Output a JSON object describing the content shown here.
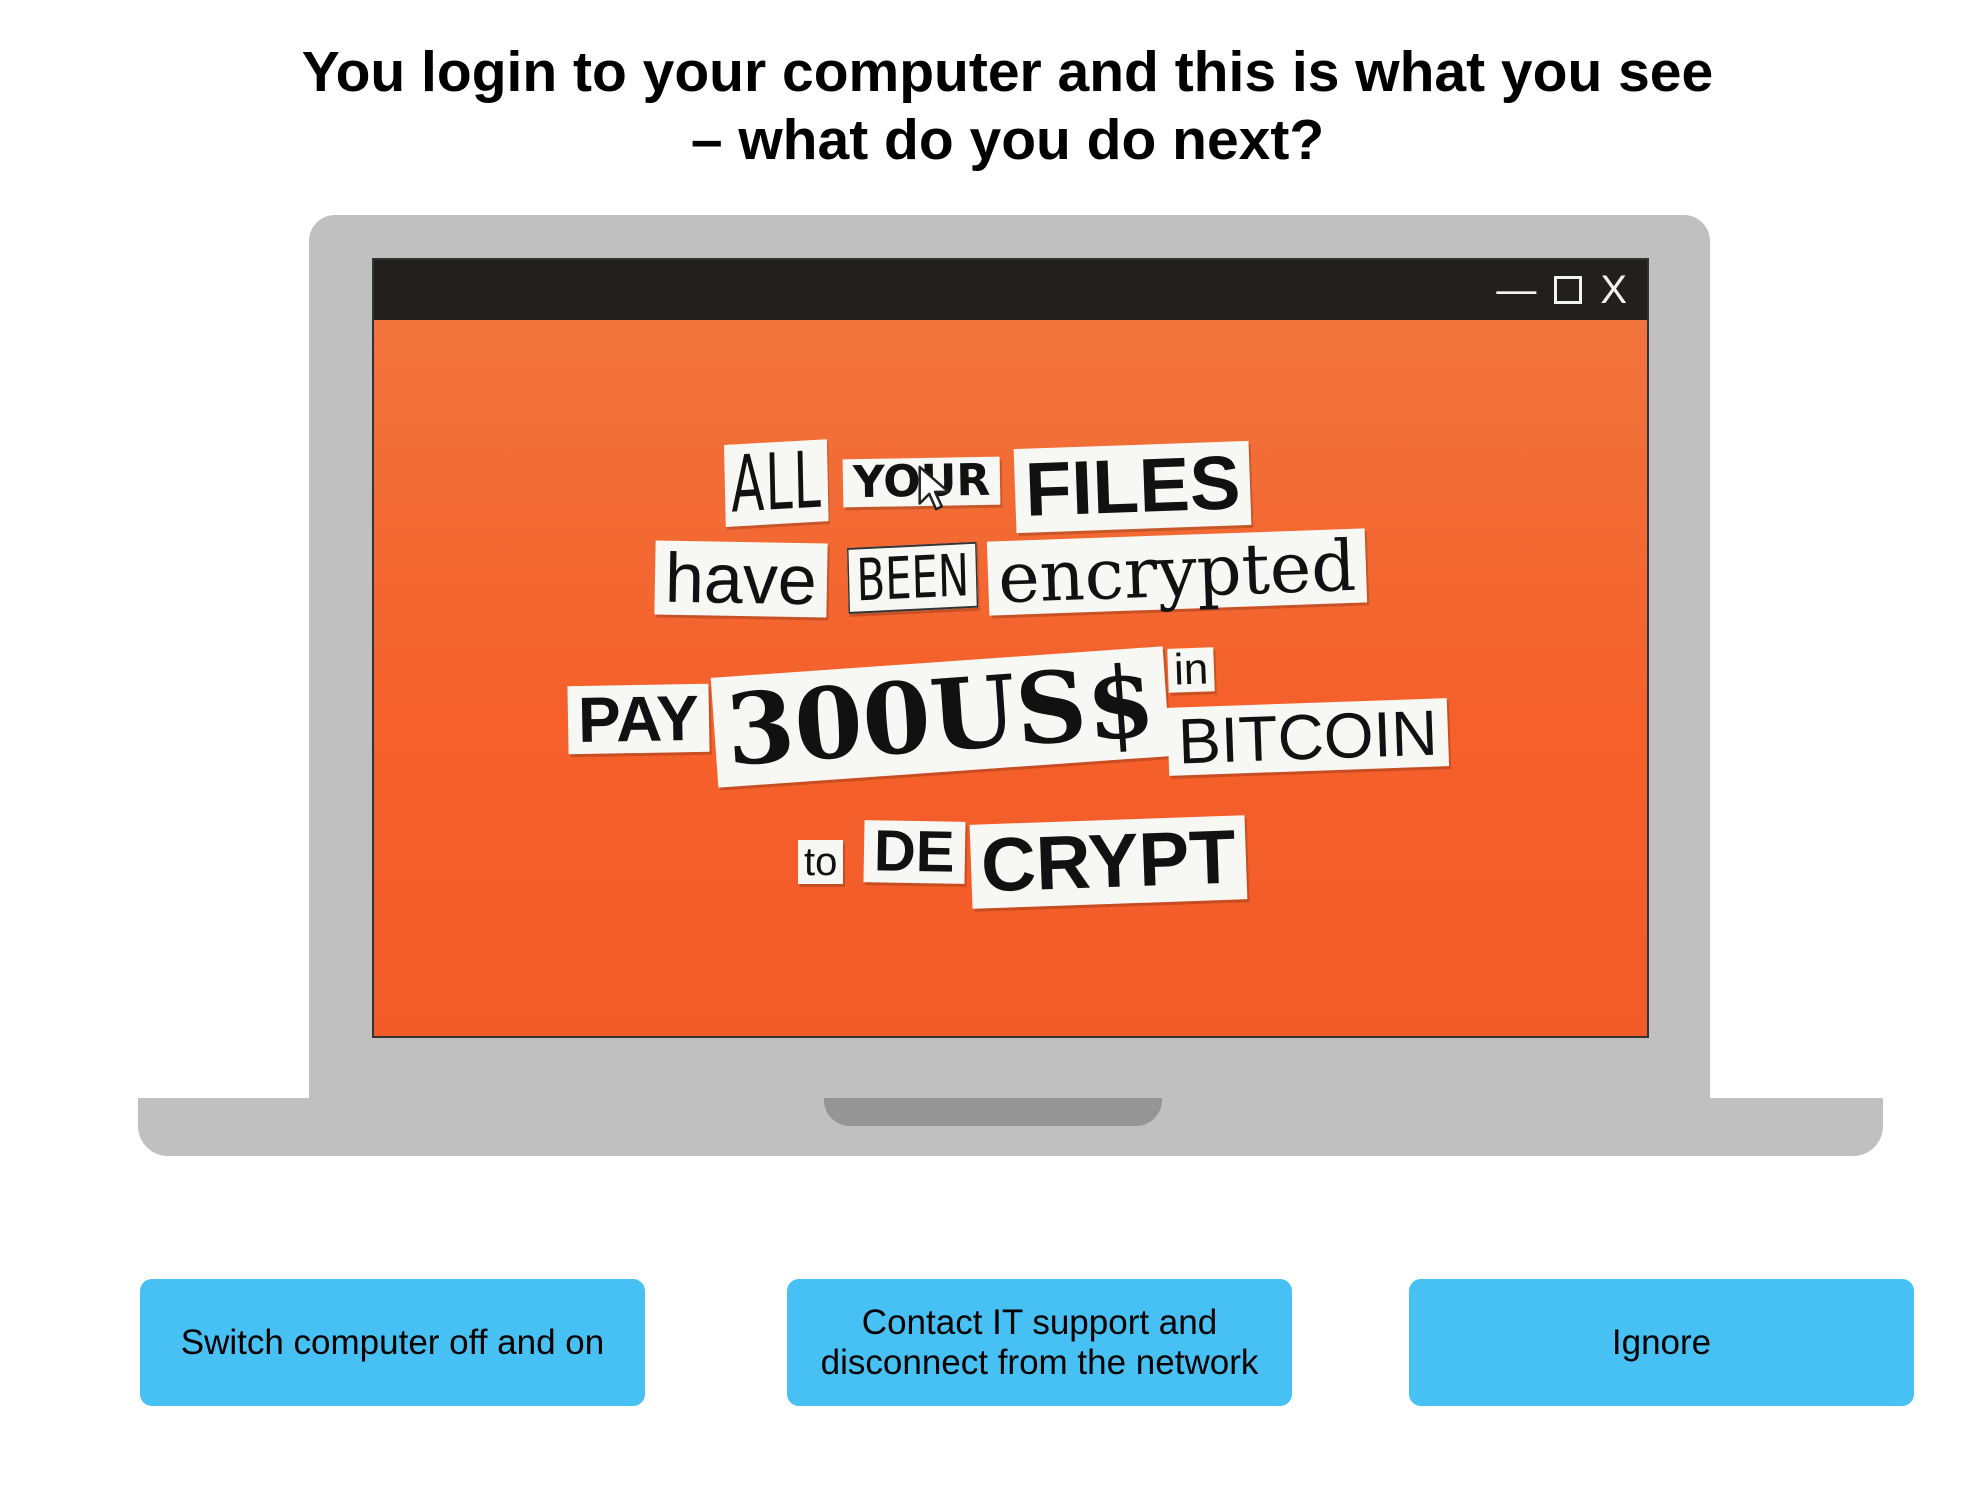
{
  "question": {
    "line1": "You login to your computer and this is what you see",
    "line2": "– what do you do next?"
  },
  "window": {
    "controls": {
      "minimize": "—",
      "maximize_icon": "square-icon",
      "close": "X"
    }
  },
  "ransom_note": {
    "all": "ALL",
    "your": "YOUR",
    "files": "FILES",
    "have": "have",
    "been": "BEEN",
    "encrypted": "encrypted",
    "pay": "PAY",
    "amount": "300US$",
    "in": "in",
    "bitcoin": "BITCOIN",
    "to": "to",
    "de": "DE",
    "crypt": "CRYPT"
  },
  "answers": [
    {
      "label": "Switch computer off and on"
    },
    {
      "label": "Contact IT support and disconnect from the network"
    },
    {
      "label": "Ignore"
    }
  ],
  "colors": {
    "button": "#47c0f4",
    "screen": "#f55a26",
    "laptop": "#c0c0c0",
    "titlebar": "#231f1e"
  }
}
